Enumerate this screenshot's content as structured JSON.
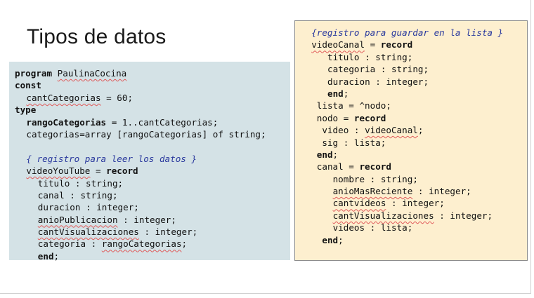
{
  "slide": {
    "title": "Tipos de datos"
  },
  "left_code": {
    "lines": [
      {
        "indent": 0,
        "parts": [
          {
            "t": "program",
            "s": "kw"
          },
          {
            "t": " "
          },
          {
            "t": "PaulinaCocina",
            "s": "sq"
          }
        ]
      },
      {
        "indent": 0,
        "parts": [
          {
            "t": "const",
            "s": "kw"
          }
        ]
      },
      {
        "indent": 2,
        "parts": [
          {
            "t": "cantCategorias",
            "s": "sq"
          },
          {
            "t": " = 60;"
          }
        ]
      },
      {
        "indent": 0,
        "parts": [
          {
            "t": "type",
            "s": "kw"
          }
        ]
      },
      {
        "indent": 2,
        "parts": [
          {
            "t": "rangoCategorias",
            "s": "kw"
          },
          {
            "t": " = 1..cantCategorias;"
          }
        ]
      },
      {
        "indent": 2,
        "parts": [
          {
            "t": "categorias=array [rangoCategorias] of string;"
          }
        ]
      },
      {
        "indent": 0,
        "parts": [
          {
            "t": ""
          }
        ]
      },
      {
        "indent": 2,
        "parts": [
          {
            "t": "{ registro para leer los datos }",
            "s": "cm"
          }
        ]
      },
      {
        "indent": 2,
        "parts": [
          {
            "t": "videoYouTube",
            "s": "sq"
          },
          {
            "t": " = "
          },
          {
            "t": "record",
            "s": "kw"
          }
        ]
      },
      {
        "indent": 4,
        "parts": [
          {
            "t": "titulo : string;"
          }
        ]
      },
      {
        "indent": 4,
        "parts": [
          {
            "t": "canal : string;"
          }
        ]
      },
      {
        "indent": 4,
        "parts": [
          {
            "t": "duracion : integer;"
          }
        ]
      },
      {
        "indent": 4,
        "parts": [
          {
            "t": "anioPublicacion",
            "s": "sq"
          },
          {
            "t": " : integer;"
          }
        ]
      },
      {
        "indent": 4,
        "parts": [
          {
            "t": "cantVisualizaciones",
            "s": "sq"
          },
          {
            "t": " : integer;"
          }
        ]
      },
      {
        "indent": 4,
        "parts": [
          {
            "t": "categoria : "
          },
          {
            "t": "rangoCategorias",
            "s": "sq"
          },
          {
            "t": ";"
          }
        ]
      },
      {
        "indent": 4,
        "parts": [
          {
            "t": "end",
            "s": "kw"
          },
          {
            "t": ";"
          }
        ]
      }
    ]
  },
  "right_code": {
    "lines": [
      {
        "indent": 2,
        "parts": [
          {
            "t": "{registro para guardar en la lista }",
            "s": "cm"
          }
        ]
      },
      {
        "indent": 2,
        "parts": [
          {
            "t": "videoCanal",
            "s": "sq"
          },
          {
            "t": " = "
          },
          {
            "t": "record",
            "s": "kw"
          }
        ]
      },
      {
        "indent": 5,
        "parts": [
          {
            "t": "titulo : string;"
          }
        ]
      },
      {
        "indent": 5,
        "parts": [
          {
            "t": "categoria : string;"
          }
        ]
      },
      {
        "indent": 5,
        "parts": [
          {
            "t": "duracion : integer;"
          }
        ]
      },
      {
        "indent": 5,
        "parts": [
          {
            "t": "end",
            "s": "kw"
          },
          {
            "t": ";"
          }
        ]
      },
      {
        "indent": 3,
        "parts": [
          {
            "t": "lista = ^nodo;"
          }
        ]
      },
      {
        "indent": 3,
        "parts": [
          {
            "t": "nodo = "
          },
          {
            "t": "record",
            "s": "kw"
          }
        ]
      },
      {
        "indent": 4,
        "parts": [
          {
            "t": "video : "
          },
          {
            "t": "videoCanal",
            "s": "sq"
          },
          {
            "t": ";"
          }
        ]
      },
      {
        "indent": 4,
        "parts": [
          {
            "t": "sig : lista;"
          }
        ]
      },
      {
        "indent": 3,
        "parts": [
          {
            "t": "end",
            "s": "kw"
          },
          {
            "t": ";"
          }
        ]
      },
      {
        "indent": 3,
        "parts": [
          {
            "t": "canal = "
          },
          {
            "t": "record",
            "s": "kw"
          }
        ]
      },
      {
        "indent": 6,
        "parts": [
          {
            "t": "nombre : string;"
          }
        ]
      },
      {
        "indent": 6,
        "parts": [
          {
            "t": "anioMasReciente",
            "s": "sq"
          },
          {
            "t": " : integer;"
          }
        ]
      },
      {
        "indent": 6,
        "parts": [
          {
            "t": "cantvideos",
            "s": "sq"
          },
          {
            "t": " : integer;"
          }
        ]
      },
      {
        "indent": 6,
        "parts": [
          {
            "t": "cantVisualizaciones",
            "s": "sq"
          },
          {
            "t": " : integer;"
          }
        ]
      },
      {
        "indent": 6,
        "parts": [
          {
            "t": "videos : lista;"
          }
        ]
      },
      {
        "indent": 4,
        "parts": [
          {
            "t": "end",
            "s": "kw"
          },
          {
            "t": ";"
          }
        ]
      }
    ]
  }
}
